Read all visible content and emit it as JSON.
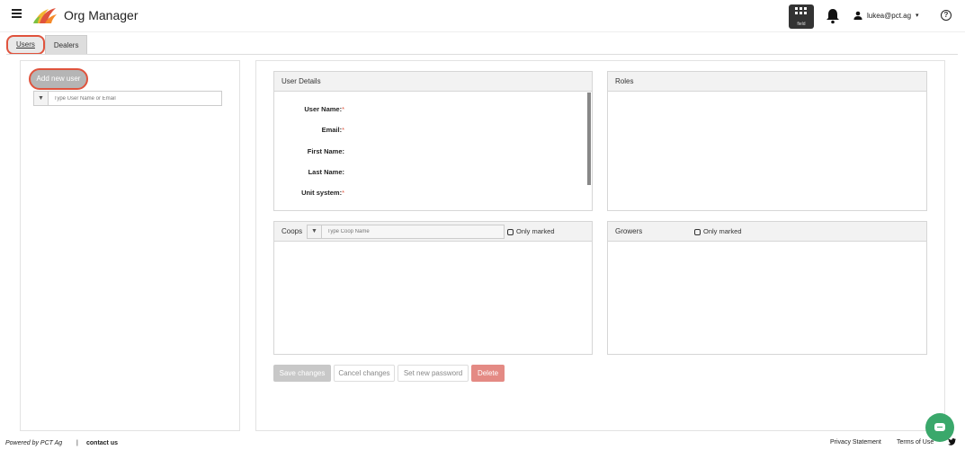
{
  "app": {
    "title": "Org Manager"
  },
  "header": {
    "apps_label": "field",
    "user_email": "lukea@pct.ag"
  },
  "tabs": [
    {
      "label": "Users",
      "active": true
    },
    {
      "label": "Dealers",
      "active": false
    }
  ],
  "left": {
    "add_user_label": "Add new user",
    "search_placeholder": "Type User Name or Email"
  },
  "user_details": {
    "title": "User Details",
    "fields": [
      {
        "label": "User Name:",
        "required": "*"
      },
      {
        "label": "Email:",
        "required": "*"
      },
      {
        "label": "First Name:",
        "required": ""
      },
      {
        "label": "Last Name:",
        "required": ""
      },
      {
        "label": "Unit system:",
        "required": "*"
      }
    ]
  },
  "roles": {
    "title": "Roles"
  },
  "coops": {
    "title": "Coops",
    "search_placeholder": "Type Coop Name",
    "only_marked_label": "Only marked"
  },
  "growers": {
    "title": "Growers",
    "only_marked_label": "Only marked"
  },
  "actions": {
    "save": "Save changes",
    "cancel": "Cancel changes",
    "reset_password": "Set new password",
    "delete": "Delete"
  },
  "footer": {
    "powered_by": "Powered by PCT Ag",
    "separator": "|",
    "contact": "contact us",
    "privacy": "Privacy Statement",
    "terms": "Terms of Use"
  },
  "colors": {
    "highlight": "#e0533d",
    "chat": "#3aa86b",
    "delete": "#e48a84"
  },
  "icons": [
    "menu-icon",
    "logo-icon",
    "apps-grid-icon",
    "bell-icon",
    "user-icon",
    "chevron-down-icon",
    "help-icon",
    "filter-icon",
    "twitter-icon",
    "chat-icon"
  ]
}
